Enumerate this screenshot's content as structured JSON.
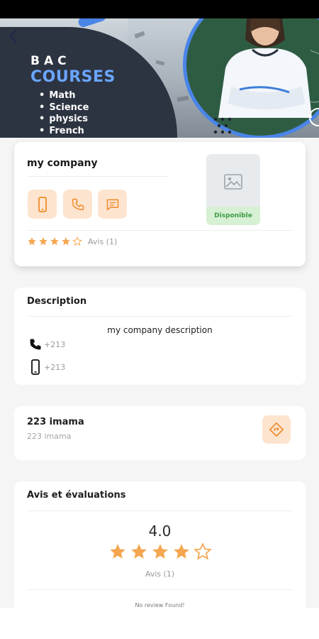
{
  "banner": {
    "bac": "BAC",
    "courses": "COURSES",
    "subjects": [
      "Math",
      "Science",
      "physics",
      "French"
    ]
  },
  "company": {
    "name": "my company",
    "availability": "Disponible",
    "rating": 4,
    "rating_count_label": "Avis (1)"
  },
  "description": {
    "title": "Description",
    "text": "my company description",
    "phone": "+213",
    "mobile": "+213"
  },
  "address": {
    "title": "223 imama",
    "subtitle": "223 imama"
  },
  "reviews": {
    "title": "Avis et évaluations",
    "average": "4.0",
    "stars": 4,
    "count_label": "Avis (1)",
    "empty_text": "No review Found!"
  },
  "colors": {
    "accent": "#f5a650",
    "accent_bg": "#fde4cf",
    "available_text": "#3f9b45",
    "banner_dark": "#2c3341",
    "banner_blue": "#4a85e8"
  }
}
